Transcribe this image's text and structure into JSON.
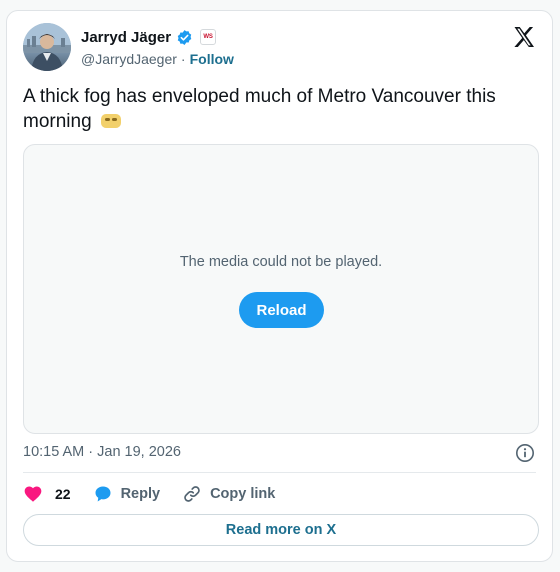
{
  "author": {
    "name": "Jarryd Jäger",
    "handle": "@JarrydJaeger",
    "separator": "·",
    "follow_label": "Follow",
    "affiliate_badge": "WS"
  },
  "tweet": {
    "text": "A thick fog has enveloped much of Metro Vancouver this morning",
    "emoji_icon": "fog-face-emoji"
  },
  "media": {
    "message": "The media could not be played.",
    "reload_label": "Reload"
  },
  "timestamp": "10:15 AM · Jan 19, 2026",
  "actions": {
    "like_count": "22",
    "reply_label": "Reply",
    "copy_link_label": "Copy link"
  },
  "read_more_label": "Read more on X",
  "colors": {
    "accent": "#1d9bf0",
    "like": "#f91880",
    "link": "#1d6f8f",
    "muted": "#536471"
  },
  "icons": {
    "verified": "verified-badge-icon",
    "logo": "x-logo-icon",
    "info": "info-icon",
    "like": "heart-icon",
    "reply": "speech-bubble-icon",
    "copy": "link-icon"
  }
}
